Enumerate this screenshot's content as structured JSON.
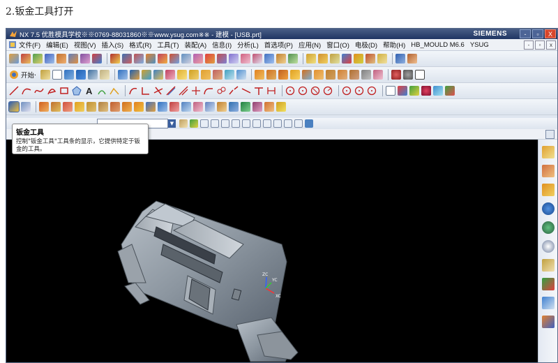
{
  "caption": "2.钣金工具打开",
  "window": {
    "title": "NX 7.5 优胜模具学校※※0769-88031860※※www.ysug.com※※ - 建模 - [USB.prt]",
    "brand": "SIEMENS",
    "controls": [
      "-",
      "▫",
      "X"
    ]
  },
  "menu": {
    "items": [
      "文件(F)",
      "编辑(E)",
      "视图(V)",
      "插入(S)",
      "格式(R)",
      "工具(T)",
      "装配(A)",
      "信息(I)",
      "分析(L)",
      "首选项(P)",
      "应用(N)",
      "窗口(O)",
      "电极(D)",
      "帮助(H)",
      "HB_MOULD M6.6",
      "YSUG"
    ],
    "right_controls": [
      "-",
      "▫",
      "x"
    ]
  },
  "toolbar": {
    "start_label": "开始·"
  },
  "tooltip": {
    "title": "钣金工具",
    "body": "控制\"钣金工具\"工具条的显示，它提供特定于钣金的工具。"
  },
  "model_axes": {
    "z": "ZC",
    "y": "YC",
    "x": "XC"
  },
  "colors": {
    "titlebar": "#1f3563",
    "viewport_bg": "#000000",
    "model": "#8c96a0",
    "close": "#d8452b"
  }
}
